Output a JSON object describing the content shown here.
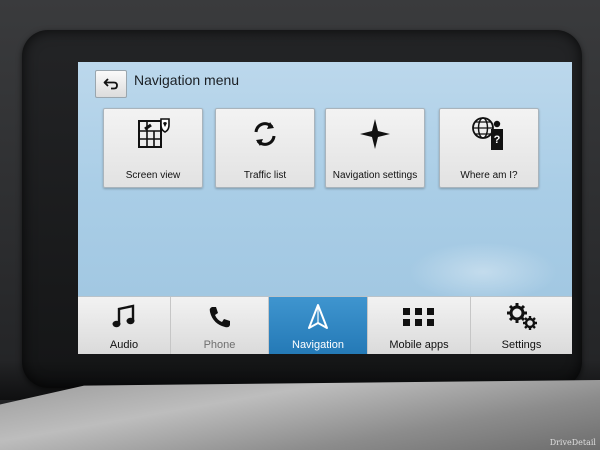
{
  "header": {
    "title": "Navigation menu",
    "back_icon": "back-arrow-icon"
  },
  "tiles": [
    {
      "label": "Screen view",
      "icon": "map-layers-icon"
    },
    {
      "label": "Traffic list",
      "icon": "refresh-arrows-icon"
    },
    {
      "label": "Navigation settings",
      "icon": "four-point-star-icon"
    },
    {
      "label": "Where am I?",
      "icon": "globe-person-question-icon"
    }
  ],
  "bottom_bar": [
    {
      "label": "Audio",
      "icon": "music-note-icon",
      "active": false
    },
    {
      "label": "Phone",
      "icon": "phone-handset-icon",
      "active": false
    },
    {
      "label": "Navigation",
      "icon": "navigation-arrow-icon",
      "active": true
    },
    {
      "label": "Mobile apps",
      "icon": "app-grid-icon",
      "active": false
    },
    {
      "label": "Settings",
      "icon": "gears-icon",
      "active": false
    }
  ],
  "colors": {
    "screen_bg": "#a9cde6",
    "active_tab": "#2f86c2",
    "tile_bg": "#ececec"
  },
  "watermark": "DriveDetail"
}
